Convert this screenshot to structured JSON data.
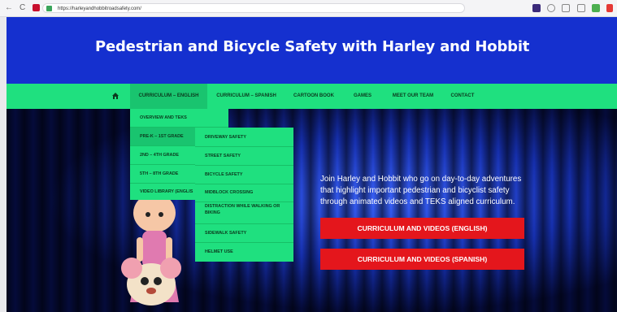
{
  "browser": {
    "url": "https://harleyandhobbitroadsafety.com/",
    "back_glyph": "←",
    "reload_glyph": "C"
  },
  "site": {
    "title": "Pedestrian and Bicycle Safety with Harley and Hobbit"
  },
  "nav": {
    "home_icon": "home-icon",
    "items": [
      {
        "label": "CURRICULUM – ENGLISH"
      },
      {
        "label": "CURRICULUM – SPANISH"
      },
      {
        "label": "CARTOON BOOK"
      },
      {
        "label": "GAMES"
      },
      {
        "label": "MEET OUR TEAM"
      },
      {
        "label": "CONTACT"
      }
    ]
  },
  "dropdown": {
    "level1": [
      {
        "label": "OVERVIEW AND TEKS"
      },
      {
        "label": "PRE-K – 1ST GRADE"
      },
      {
        "label": "2ND – 4TH GRADE"
      },
      {
        "label": "5TH – 8TH GRADE"
      },
      {
        "label": "VIDEO LIBRARY (ENGLIS"
      }
    ],
    "level2": [
      {
        "label": "DRIVEWAY SAFETY"
      },
      {
        "label": "STREET SAFETY"
      },
      {
        "label": "BICYCLE SAFETY"
      },
      {
        "label": "MIDBLOCK CROSSING"
      },
      {
        "label": "DISTRACTION WHILE WALKING OR"
      },
      {
        "label": "BIKING"
      },
      {
        "label": "SIDEWALK SAFETY"
      },
      {
        "label": "HELMET USE"
      }
    ]
  },
  "hero": {
    "intro": "Join Harley and Hobbit who go on day-to-day adventures that highlight important pedestrian and bicyclist safety through animated videos and TEKS aligned curriculum.",
    "cta_english": "CURRICULUM AND VIDEOS (ENGLISH)",
    "cta_spanish": "CURRICULUM AND VIDEOS (SPANISH)"
  },
  "colors": {
    "header_blue": "#1530cf",
    "nav_green": "#1fe07f",
    "cta_red": "#e4161c"
  }
}
